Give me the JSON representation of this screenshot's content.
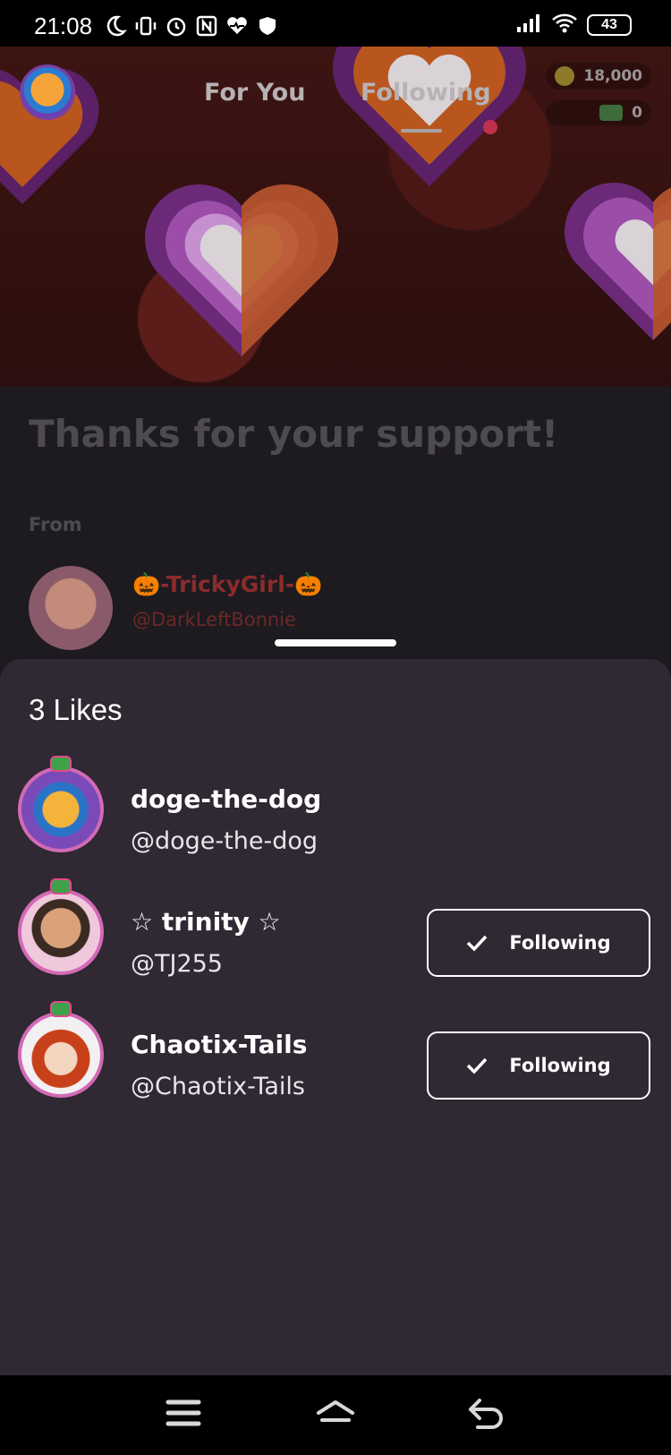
{
  "status_bar": {
    "time": "21:08",
    "battery": "43",
    "icons": [
      "moon-icon",
      "vibrate-icon",
      "alarm-icon",
      "nfc-icon",
      "health-icon",
      "shield-icon",
      "signal-icon",
      "wifi-icon",
      "battery-icon"
    ]
  },
  "top_nav": {
    "tabs": [
      {
        "label": "For You",
        "active": false
      },
      {
        "label": "Following",
        "active": true,
        "has_notification_dot": true
      }
    ],
    "wallet": {
      "coins": "18,000",
      "cash": "0"
    }
  },
  "post": {
    "title": "Thanks for your support!",
    "from_label": "From",
    "author_name": "🎃-TrickyGirl-🎃",
    "author_handle": "@DarkLeftBonnie"
  },
  "likes_sheet": {
    "title": "3 Likes",
    "users": [
      {
        "display_name": "doge-the-dog",
        "handle": "@doge-the-dog",
        "follow_label": ""
      },
      {
        "display_name": "☆ trinity ☆",
        "handle": "@TJ255",
        "follow_label": "Following"
      },
      {
        "display_name": "Chaotix-Tails",
        "handle": "@Chaotix-Tails",
        "follow_label": "Following"
      }
    ]
  },
  "nav_bar": {
    "buttons": [
      "menu-icon",
      "home-icon",
      "back-icon"
    ]
  },
  "colors": {
    "sheet_bg": "#302833",
    "accent_pink": "#d36ab6",
    "notification_dot": "#c0304a"
  }
}
